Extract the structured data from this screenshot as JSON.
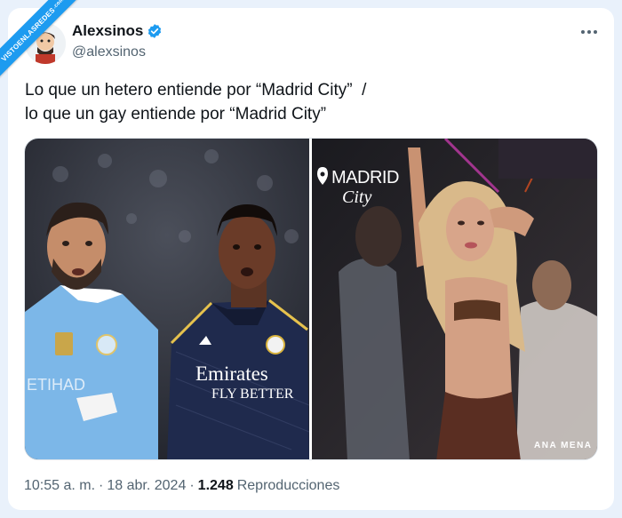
{
  "watermark": {
    "text": "VISTOENLASREDES",
    "suffix": ".com"
  },
  "author": {
    "display_name": "Alexsinos",
    "handle": "@alexsinos",
    "verified": true
  },
  "tweet": {
    "line1": "Lo que un hetero entiende por “Madrid City”  /",
    "line2": "lo que un gay entiende por “Madrid City”"
  },
  "media": {
    "left_kit_text_1": "Emirates",
    "left_kit_text_2": "FLY BETTER",
    "left_badge_text": "ETIHAD",
    "right_neon_1": "MADRID",
    "right_neon_2": "City",
    "right_artist": "ANA MENA"
  },
  "footer": {
    "time": "10:55 a. m.",
    "separator": "·",
    "date": "18 abr. 2024",
    "views": "1.248",
    "views_label": "Reproducciones"
  },
  "colors": {
    "accent": "#1d9bf0",
    "text_primary": "#0f1419",
    "text_secondary": "#536471",
    "background": "#e9f1fb"
  },
  "icons": [
    "verified-badge-icon",
    "more-options-icon",
    "location-pin-icon"
  ]
}
